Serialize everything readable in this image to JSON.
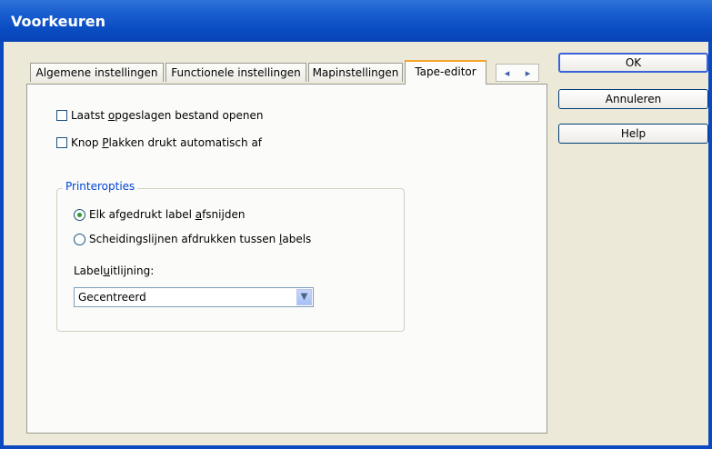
{
  "window": {
    "title": "Voorkeuren"
  },
  "tabs": [
    {
      "label": "Algemene instellingen"
    },
    {
      "label": "Functionele instellingen"
    },
    {
      "label": "Mapinstellingen"
    },
    {
      "label": "Tape-editor"
    }
  ],
  "tab_scroll": {
    "left": "◂",
    "right": "▸"
  },
  "checkboxes": {
    "open_last": {
      "label_pre": "Laatst ",
      "label_ul": "o",
      "label_post": "pgeslagen bestand openen",
      "checked": false
    },
    "auto_print": {
      "label_pre": "Knop ",
      "label_ul": "P",
      "label_post": "lakken drukt automatisch af",
      "checked": false
    }
  },
  "printer_options": {
    "legend": "Printeropties",
    "radio_cut": {
      "label_pre": "Elk afgedrukt label ",
      "label_ul": "a",
      "label_post": "fsnijden",
      "checked": true
    },
    "radio_lines": {
      "label_pre": "Scheidingslijnen afdrukken tussen ",
      "label_ul": "l",
      "label_post": "abels",
      "checked": false
    },
    "alignment_label_pre": "Label",
    "alignment_label_ul": "u",
    "alignment_label_post": "itlijning:",
    "alignment_value": "Gecentreerd"
  },
  "buttons": {
    "ok": "OK",
    "cancel": "Annuleren",
    "help": "Help"
  },
  "colors": {
    "titlebar": "#0a4cc2",
    "active_tab_accent": "#f6a32a",
    "group_legend": "#0046d5",
    "radio_dot": "#2f9a2f"
  }
}
